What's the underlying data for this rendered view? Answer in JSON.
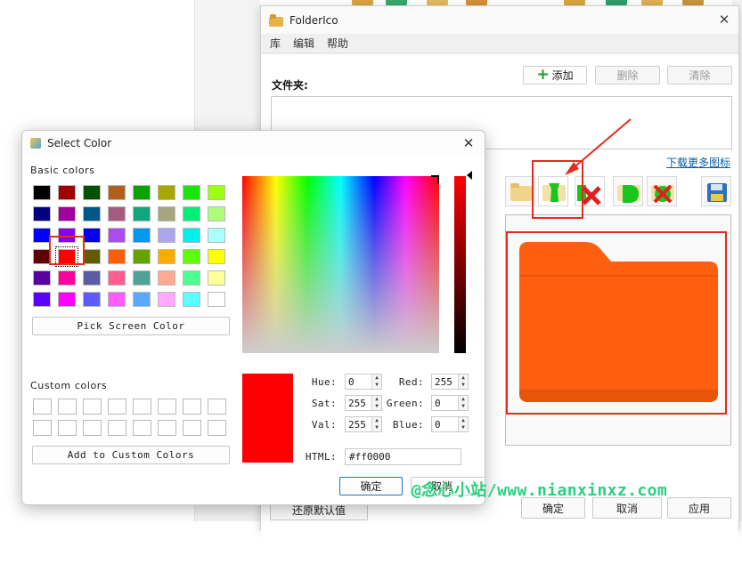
{
  "colors": {
    "accent_red": "#e52b1f",
    "folder_orange": "#ff5f0f",
    "watermark_green": "#27d07e",
    "link_blue": "#0b5ea8"
  },
  "main_window": {
    "title": "FolderIco",
    "icon": "folderico-app-icon",
    "menu": [
      "库",
      "编辑",
      "帮助"
    ],
    "folder_label": "文件夹:",
    "add_button": "添加",
    "delete_button": "删除",
    "clear_button": "清除",
    "download_link": "下载更多图标",
    "toolbar_icons": [
      "folder-icon",
      "green-folder-tag-icon",
      "remove-red-x-icon",
      "green-folder-d-icon",
      "remove-green-x-icon",
      "save-disk-icon"
    ],
    "preview_icon": "orange-folder-icon",
    "restore_button": "还原默认值",
    "ok_button": "确定",
    "cancel_button": "取消",
    "apply_button": "应用"
  },
  "dialog": {
    "title": "Select Color",
    "basic_colors_label": "Basic colors",
    "basic_colors": [
      "#000000",
      "#a00000",
      "#005000",
      "#b35e1e",
      "#08a300",
      "#a6a800",
      "#19e50a",
      "#9dff19",
      "#020080",
      "#a0009e",
      "#00588a",
      "#a65a80",
      "#10a67e",
      "#a6a57e",
      "#00ee76",
      "#aaff77",
      "#0000ff",
      "#8a00ee",
      "#0000ee",
      "#ab4cee",
      "#0099ee",
      "#aba6ee",
      "#00eeee",
      "#aaffff",
      "#5e0000",
      "#ff0000",
      "#5e5e00",
      "#ff5f00",
      "#66a200",
      "#ffaa00",
      "#5eff00",
      "#ffff00",
      "#5b00a0",
      "#ff00a0",
      "#5b5ba6",
      "#ff5c90",
      "#4ea398",
      "#ffaa90",
      "#4cff90",
      "#ffff99",
      "#5b00ff",
      "#ff00ff",
      "#5b5bff",
      "#ff5cff",
      "#5ba8ff",
      "#ffaaff",
      "#5cffff",
      "#ffffff"
    ],
    "selected_swatch_index": 25,
    "pick_screen_color": "Pick Screen Color",
    "custom_colors_label": "Custom colors",
    "add_custom": "Add to Custom Colors",
    "fields": {
      "hue": {
        "label": "Hue:",
        "value": "0"
      },
      "sat": {
        "label": "Sat:",
        "value": "255"
      },
      "val": {
        "label": "Val:",
        "value": "255"
      },
      "red": {
        "label": "Red:",
        "value": "255"
      },
      "green": {
        "label": "Green:",
        "value": "0"
      },
      "blue": {
        "label": "Blue:",
        "value": "0"
      },
      "html": {
        "label": "HTML:",
        "value": "#ff0000"
      }
    },
    "current_color": "#ff0000",
    "ok": "确定",
    "cancel": "取消"
  },
  "watermark": "@念心小站/www.nianxinxz.com"
}
